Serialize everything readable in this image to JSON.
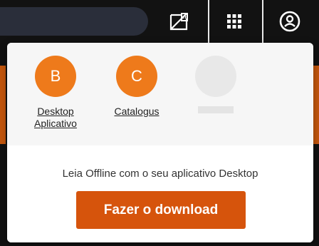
{
  "topbar": {
    "icons": [
      "no-sim-icon",
      "apps-grid-icon",
      "account-circle-icon"
    ]
  },
  "apps": [
    {
      "initial": "B",
      "label": "Desktop Aplicativo",
      "color": "#ee7a1b"
    },
    {
      "initial": "C",
      "label": "Catalogus",
      "color": "#ee7a1b"
    },
    {
      "initial": "",
      "label": "",
      "color": "#e8e8e8"
    }
  ],
  "offline": {
    "tagline": "Leia Offline com o seu aplicativo Desktop",
    "download_label": "Fazer o download"
  },
  "colors": {
    "accent": "#ee7a1b",
    "button": "#d6540c",
    "topbar": "#121212"
  }
}
